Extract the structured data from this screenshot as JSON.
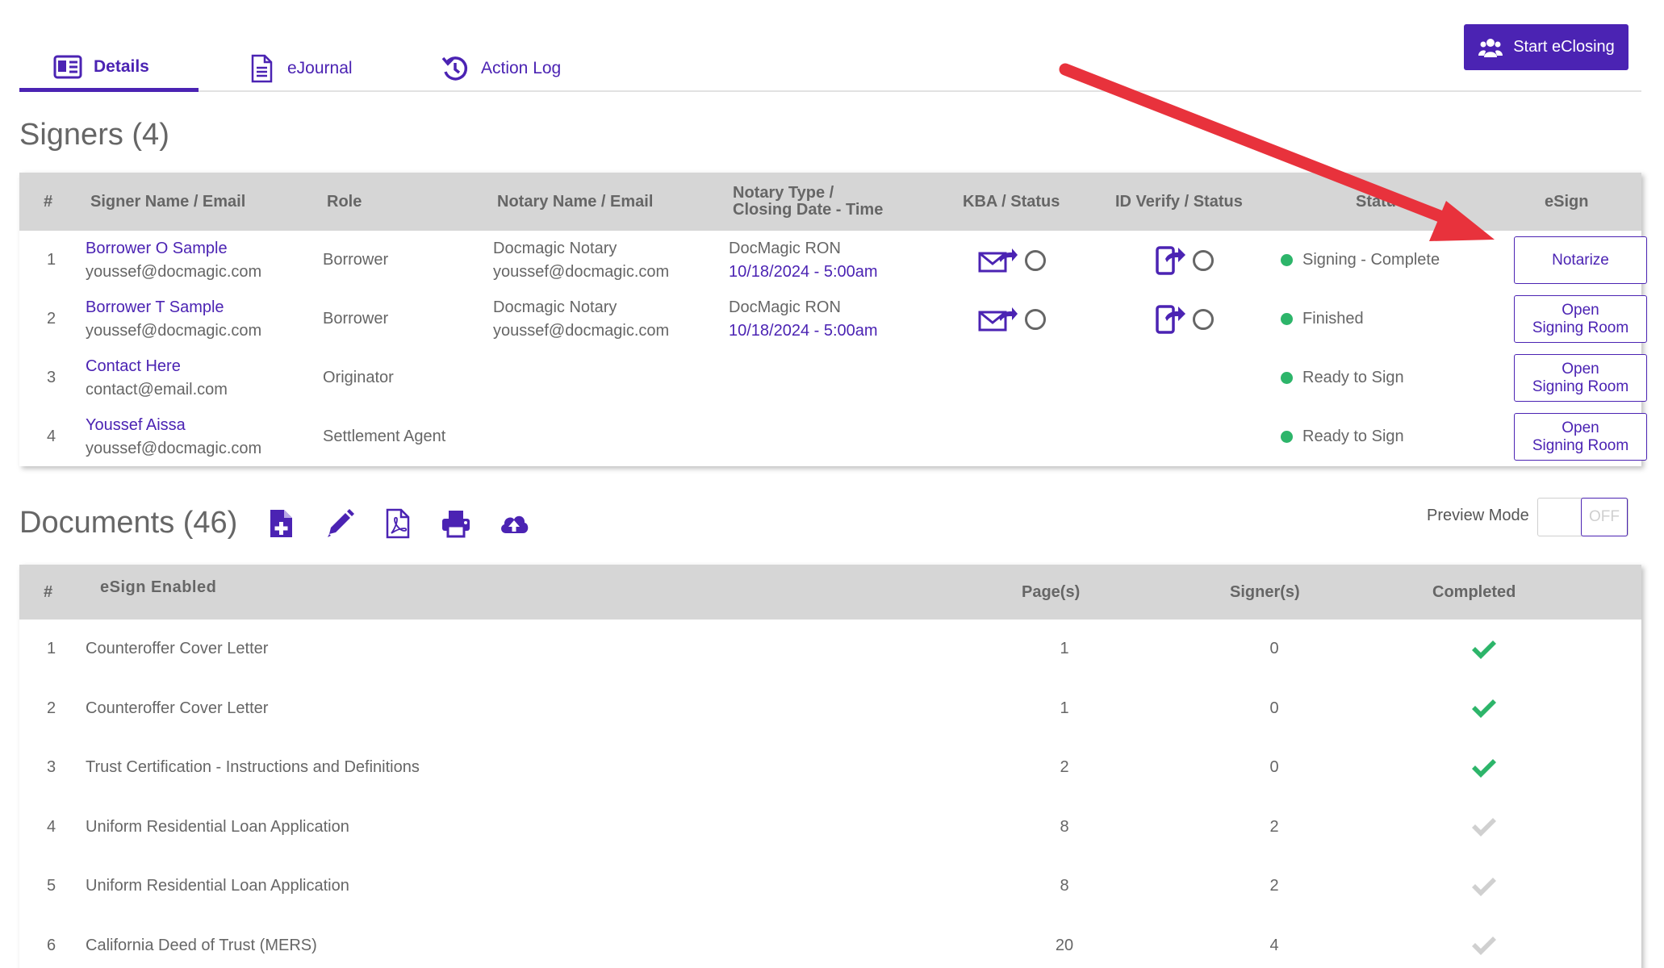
{
  "tabs": [
    {
      "label": "Details",
      "icon": "id-card-icon",
      "active": true
    },
    {
      "label": "eJournal",
      "icon": "document-icon",
      "active": false
    },
    {
      "label": "Action Log",
      "icon": "history-icon",
      "active": false
    }
  ],
  "start_button": {
    "label": "Start eClosing",
    "icon": "users-icon"
  },
  "signers": {
    "title": "Signers (4)",
    "headers": {
      "num": "#",
      "name": "Signer Name / Email",
      "role": "Role",
      "notary": "Notary Name / Email",
      "notary_type_1": "Notary Type /",
      "notary_type_2": "Closing Date - Time",
      "kba": "KBA / Status",
      "idverify": "ID Verify / Status",
      "status": "Status",
      "esign": "eSign"
    },
    "rows": [
      {
        "num": "1",
        "name": "Borrower O Sample",
        "email": "youssef@docmagic.com",
        "role": "Borrower",
        "notary_name": "Docmagic Notary",
        "notary_email": "youssef@docmagic.com",
        "notary_type": "DocMagic RON",
        "date": "10/18/2024 - 5:00am",
        "status": "Signing - Complete",
        "esign_1": "Notarize",
        "esign_2": ""
      },
      {
        "num": "2",
        "name": "Borrower T Sample",
        "email": "youssef@docmagic.com",
        "role": "Borrower",
        "notary_name": "Docmagic Notary",
        "notary_email": "youssef@docmagic.com",
        "notary_type": "DocMagic RON",
        "date": "10/18/2024 - 5:00am",
        "status": "Finished",
        "esign_1": "Open",
        "esign_2": "Signing Room"
      },
      {
        "num": "3",
        "name": "Contact Here",
        "email": "contact@email.com",
        "role": "Originator",
        "status": "Ready to Sign",
        "esign_1": "Open",
        "esign_2": "Signing Room"
      },
      {
        "num": "4",
        "name": "Youssef Aissa",
        "email": "youssef@docmagic.com",
        "role": "Settlement Agent",
        "status": "Ready to Sign",
        "esign_1": "Open",
        "esign_2": "Signing Room"
      }
    ]
  },
  "documents": {
    "title": "Documents (46)",
    "tools": [
      "add-document-icon",
      "pencil-icon",
      "pdf-icon",
      "print-icon",
      "cloud-upload-icon"
    ],
    "preview_label": "Preview Mode",
    "toggle_label": "OFF",
    "headers": {
      "num": "#",
      "name": "eSign Enabled",
      "pages": "Page(s)",
      "signers": "Signer(s)",
      "completed": "Completed"
    },
    "rows": [
      {
        "num": "1",
        "name": "Counteroffer Cover Letter",
        "pages": "1",
        "signers": "0",
        "completed": true
      },
      {
        "num": "2",
        "name": "Counteroffer Cover Letter",
        "pages": "1",
        "signers": "0",
        "completed": true
      },
      {
        "num": "3",
        "name": "Trust Certification - Instructions and Definitions",
        "pages": "2",
        "signers": "0",
        "completed": true
      },
      {
        "num": "4",
        "name": "Uniform Residential Loan Application",
        "pages": "8",
        "signers": "2",
        "completed": false
      },
      {
        "num": "5",
        "name": "Uniform Residential Loan Application",
        "pages": "8",
        "signers": "2",
        "completed": false
      },
      {
        "num": "6",
        "name": "California Deed of Trust (MERS)",
        "pages": "20",
        "signers": "4",
        "completed": false
      }
    ]
  },
  "colors": {
    "accent": "#4b23b3",
    "complete": "#2db56a",
    "incomplete": "#d0d0d0",
    "header": "#d6d6d6",
    "annotation_arrow": "#e8323c"
  }
}
